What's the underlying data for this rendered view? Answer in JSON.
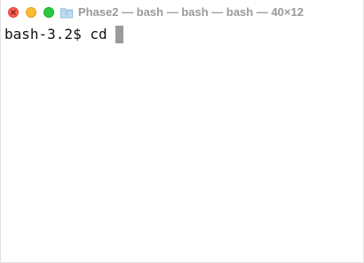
{
  "window": {
    "title": "Phase2 — bash — bash — bash — 40×12"
  },
  "icons": {
    "close": "close-icon",
    "minimize": "minimize-icon",
    "zoom": "zoom-icon",
    "folder": "folder-icon"
  },
  "colors": {
    "close": "#fe5f57",
    "minimize": "#febc2e",
    "zoom": "#28c840",
    "cursor": "#9b9b9b",
    "text": "#111111"
  },
  "terminal": {
    "prompt": "bash-3.2$ ",
    "command": "cd "
  }
}
